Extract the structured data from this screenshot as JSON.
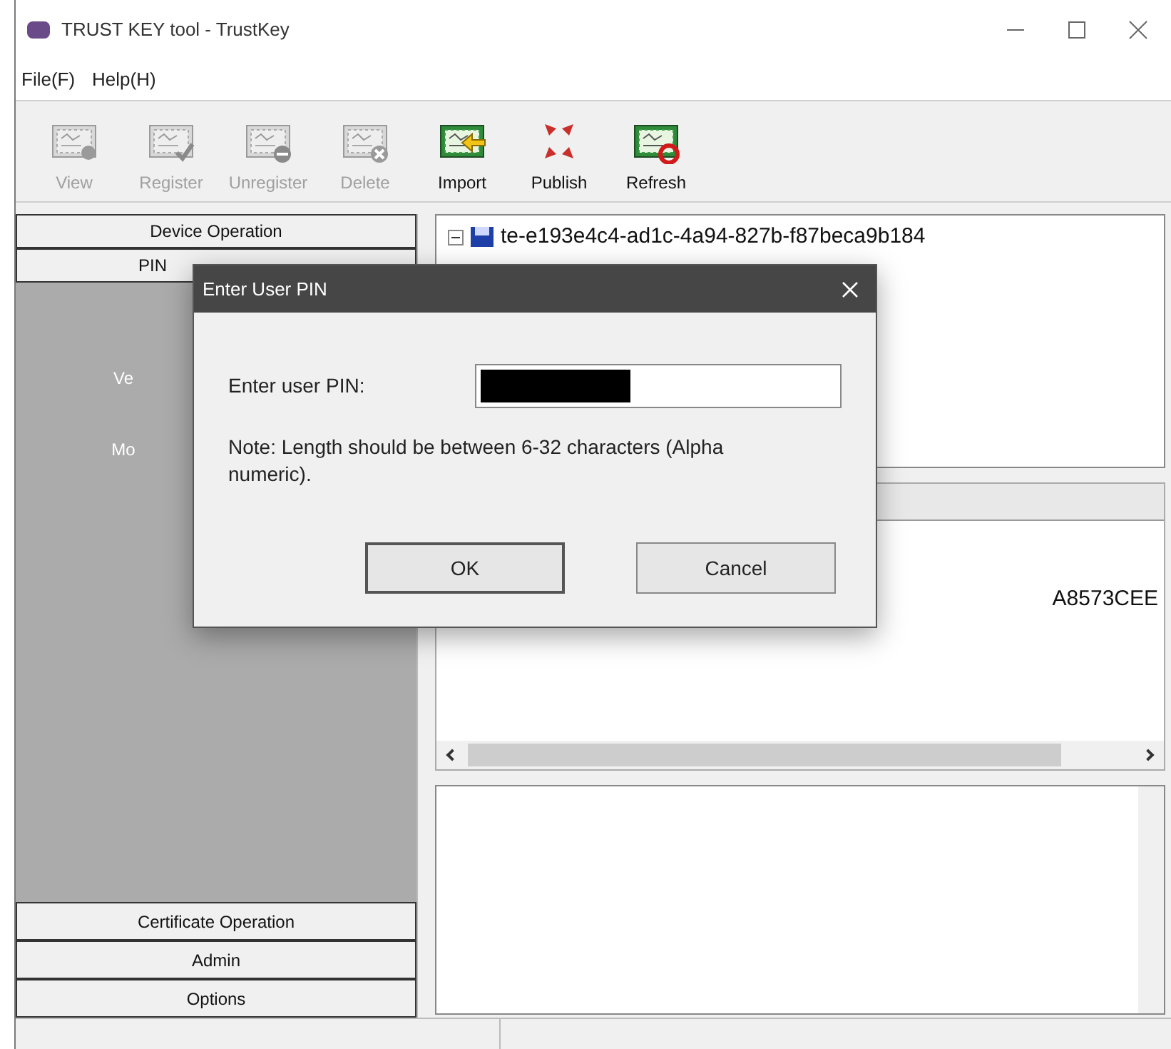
{
  "window": {
    "title": "TRUST KEY tool - TrustKey"
  },
  "menu": [
    "File(F)",
    "Help(H)"
  ],
  "toolbar": [
    {
      "label": "View",
      "disabled": true,
      "kind": "view"
    },
    {
      "label": "Register",
      "disabled": true,
      "kind": "register"
    },
    {
      "label": "Unregister",
      "disabled": true,
      "kind": "unregister"
    },
    {
      "label": "Delete",
      "disabled": true,
      "kind": "delete"
    },
    {
      "label": "Import",
      "disabled": false,
      "kind": "import"
    },
    {
      "label": "Publish",
      "disabled": false,
      "kind": "publish"
    },
    {
      "label": "Refresh",
      "disabled": false,
      "kind": "refresh"
    }
  ],
  "sidebar": {
    "top_sections": [
      {
        "label": "Device Operation",
        "covered": false
      },
      {
        "label": "PIN",
        "covered": true
      }
    ],
    "items": [
      "Ve",
      "Mo"
    ],
    "bottom_sections": [
      "Certificate Operation",
      "Admin",
      "Options"
    ]
  },
  "tree": {
    "items": [
      {
        "label": "te-e193e4c4-ad1c-4a94-827b-f87beca9b184",
        "expanded": true
      }
    ]
  },
  "list": {
    "cell": "A8573CEE"
  },
  "dialog": {
    "title": "Enter User PIN",
    "field_label": "Enter user PIN:",
    "note": "Note: Length should be between 6-32 characters (Alpha numeric).",
    "buttons": [
      {
        "label": "OK",
        "default": true
      },
      {
        "label": "Cancel",
        "default": false
      }
    ]
  }
}
